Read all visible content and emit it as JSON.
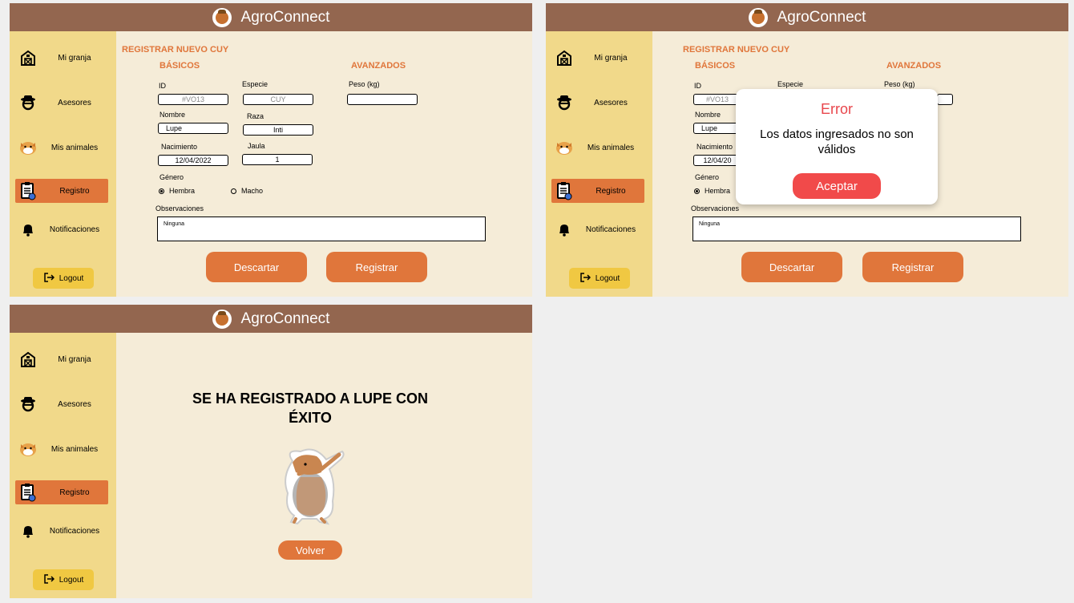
{
  "app": {
    "title": "AgroConnect"
  },
  "sidebar": {
    "items": [
      {
        "label": "Mi granja",
        "icon": "barn-icon"
      },
      {
        "label": "Asesores",
        "icon": "farmer-icon"
      },
      {
        "label": "Mis animales",
        "icon": "hamster-icon"
      },
      {
        "label": "Registro",
        "icon": "clipboard-icon"
      },
      {
        "label": "Notificaciones",
        "icon": "bell-icon"
      }
    ],
    "logout": "Logout"
  },
  "form": {
    "title": "REGISTRAR NUEVO CUY",
    "basic_title": "BÁSICOS",
    "advanced_title": "AVANZADOS",
    "id_label": "ID",
    "id_value": "#VO13",
    "especie_label": "Especie",
    "especie_value": "CUY",
    "peso_label": "Peso (kg)",
    "peso_value": "",
    "nombre_label": "Nombre",
    "nombre_value": "Lupe",
    "raza_label": "Raza",
    "raza_value": "Inti",
    "nacimiento_label": "Nacimiento",
    "nacimiento_value": "12/04/2022",
    "jaula_label": "Jaula",
    "jaula_value": "1",
    "genero_label": "Género",
    "genero_options": [
      "Hembra",
      "Macho"
    ],
    "genero_selected": "Hembra",
    "obs_label": "Observaciones",
    "obs_value": "Ninguna",
    "discard_button": "Descartar",
    "register_button": "Registrar"
  },
  "frame2_form": {
    "nombre_value": "Lupe",
    "nacimiento_value": "12/04/20",
    "id_value": "#VO13"
  },
  "error_modal": {
    "title": "Error",
    "message": "Los datos ingresados no son válidos",
    "button": "Aceptar"
  },
  "success": {
    "message": "SE HA REGISTRADO A LUPE CON ÉXITO",
    "button": "Volver"
  },
  "colors": {
    "header": "#93664f",
    "sidebar": "#f1d98a",
    "content_bg": "#f5ecd8",
    "accent": "#e0763b",
    "logout_bg": "#f0c842",
    "error": "#e8464c",
    "error_button": "#f14a4a"
  }
}
